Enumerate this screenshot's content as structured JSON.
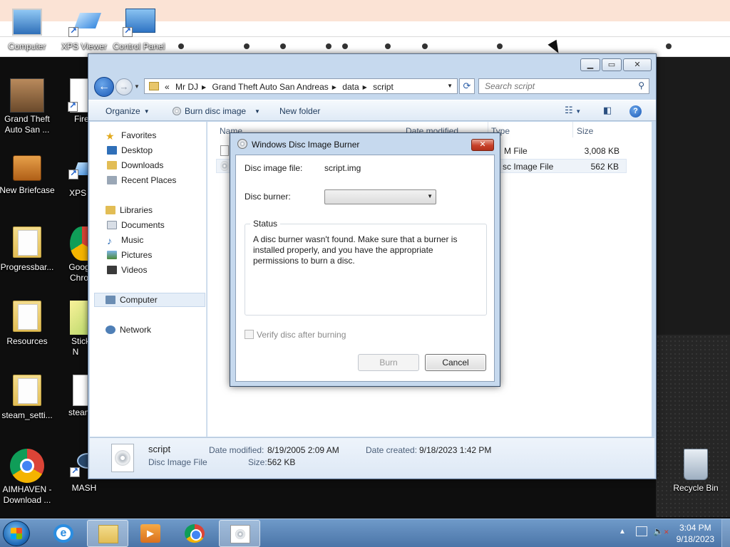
{
  "desktop": {
    "icons": {
      "computer": "Computer",
      "xps_viewer": "XPS Viewer",
      "control_panel": "Control Panel",
      "gta_sa": "Grand Theft Auto San ...",
      "firefox": "Firef",
      "new_briefcase": "New Briefcase",
      "xps_vi": "XPS Vi",
      "progressbar": "Progressbar...",
      "google_chrome": "Goog Chro",
      "resources": "Resources",
      "sticky_notes": "Sticky N",
      "steam_settings": "steam_setti...",
      "steam_a": "steam_a",
      "aimhaven": "AIMHAVEN - Download ...",
      "mash": "MASH",
      "recycle_bin": "Recycle Bin"
    }
  },
  "explorer": {
    "breadcrumb": [
      "Mr DJ",
      "Grand Theft Auto San Andreas",
      "data",
      "script"
    ],
    "breadcrumb_prefix": "«",
    "search_placeholder": "Search script",
    "toolbar": {
      "organize": "Organize",
      "burn": "Burn disc image",
      "new_folder": "New folder"
    },
    "nav": {
      "favorites": "Favorites",
      "desktop": "Desktop",
      "downloads": "Downloads",
      "recent_places": "Recent Places",
      "libraries": "Libraries",
      "documents": "Documents",
      "music": "Music",
      "pictures": "Pictures",
      "videos": "Videos",
      "computer": "Computer",
      "network": "Network"
    },
    "columns": {
      "name": "Name",
      "date_modified": "Date modified",
      "type": "Type",
      "size": "Size"
    },
    "rows": [
      {
        "type": "M File",
        "size": "3,008 KB"
      },
      {
        "type": "sc Image File",
        "size": "562 KB"
      }
    ],
    "details": {
      "name": "script",
      "kind": "Disc Image File",
      "date_modified_label": "Date modified:",
      "date_modified": "8/19/2005 2:09 AM",
      "size_label": "Size:",
      "size": "562 KB",
      "date_created_label": "Date created:",
      "date_created": "9/18/2023 1:42 PM"
    }
  },
  "dialog": {
    "title": "Windows Disc Image Burner",
    "image_file_label": "Disc image file:",
    "image_file": "script.img",
    "burner_label": "Disc burner:",
    "burner_value": "",
    "status_legend": "Status",
    "status_text": "A disc burner wasn't found. Make sure that a burner is installed properly, and you have the appropriate permissions to burn a disc.",
    "verify_label": "Verify disc after burning",
    "verify_checked": false,
    "burn_button": "Burn",
    "cancel_button": "Cancel"
  },
  "taskbar": {
    "time": "3:04 PM",
    "date": "9/18/2023"
  }
}
